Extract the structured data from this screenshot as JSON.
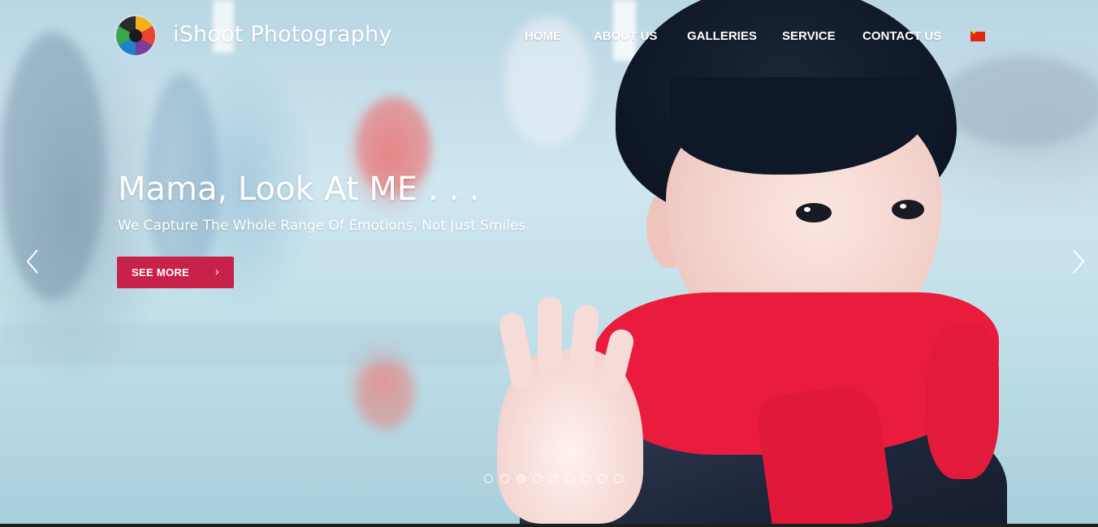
{
  "header": {
    "brand": "iShoot Photography",
    "nav": [
      {
        "label": "HOME"
      },
      {
        "label": "ABOUT US"
      },
      {
        "label": "GALLERIES"
      },
      {
        "label": "SERVICE"
      },
      {
        "label": "CONTACT US"
      }
    ],
    "language_flag": "china-flag-icon"
  },
  "slide": {
    "title": "Mama, Look At ME . . .",
    "subtitle": "We Capture The Whole Range Of Emotions, Not Just Smiles.",
    "button_label": "SEE MORE",
    "button_icon": "chevron-right-icon",
    "accent_color": "#c8224a"
  },
  "carousel": {
    "prev_icon": "chevron-left-icon",
    "next_icon": "chevron-right-icon",
    "dot_count": 9,
    "active_index": 2
  }
}
